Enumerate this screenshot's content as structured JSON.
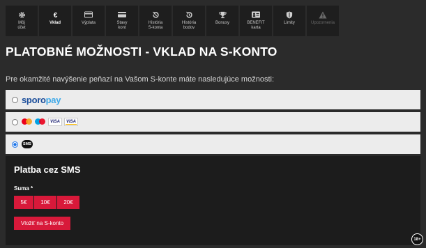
{
  "nav": {
    "tabs": [
      {
        "label": "Môj\núčet",
        "icon": "gear-icon"
      },
      {
        "label": "Vklad",
        "icon": "euro-icon"
      },
      {
        "label": "Výplata",
        "icon": "card-icon"
      },
      {
        "label": "Stavy\nkont",
        "icon": "wallet-card-icon"
      },
      {
        "label": "História\nS-konta",
        "icon": "history-icon"
      },
      {
        "label": "História\nbodov",
        "icon": "history-icon"
      },
      {
        "label": "Bonusy",
        "icon": "trophy-icon"
      },
      {
        "label": "BENEFIT\nkarta",
        "icon": "id-card-icon"
      },
      {
        "label": "Limity",
        "icon": "shield-icon"
      },
      {
        "label": "Upozornenia",
        "icon": "warning-icon"
      }
    ]
  },
  "page": {
    "title": "PLATOBNÉ MOŽNOSTI - VKLAD NA S-KONTO",
    "intro": "Pre okamžité navýšenie peňazí na Vašom S-konte máte nasledujúce možnosti:"
  },
  "options": {
    "sporopay": {
      "part1": "sporo",
      "part2": "pay"
    },
    "cards": {
      "visa1": "VISA",
      "visa2": "VISA"
    },
    "sms": {
      "badge": "SMS"
    }
  },
  "sms_panel": {
    "title": "Platba cez SMS",
    "sum_label": "Suma *",
    "amounts": [
      "5€",
      "10€",
      "20€"
    ],
    "deposit_button": "Vložiť na S-konto"
  },
  "age_badge": "18+",
  "colors": {
    "accent": "#d8193a",
    "background": "#2b2b2b",
    "tab": "#1e1e1e"
  }
}
